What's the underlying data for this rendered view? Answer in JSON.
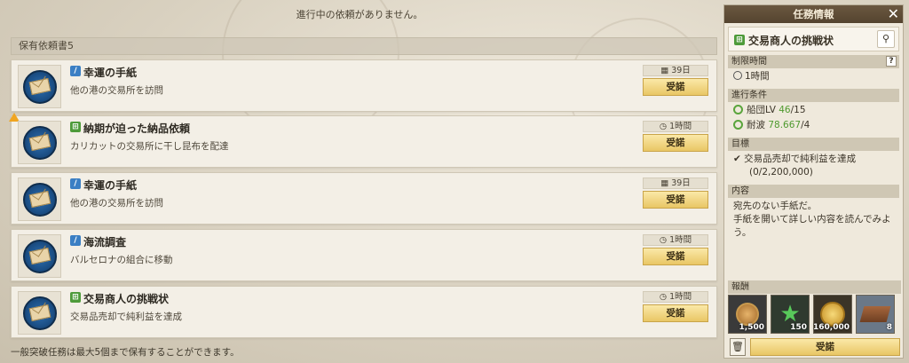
{
  "notice": "進行中の依頼がありません。",
  "list_header": "保有依頼書5",
  "accept_label": "受諾",
  "quests": [
    {
      "tag": "blue",
      "title": "幸運の手紙",
      "desc": "他の港の交易所を訪問",
      "time": "39日",
      "time_icon": "calendar-icon",
      "warning": false
    },
    {
      "tag": "green",
      "title": "納期が迫った納品依頼",
      "desc": "カリカットの交易所に干し昆布を配達",
      "time": "1時間",
      "time_icon": "clock-icon",
      "warning": true
    },
    {
      "tag": "blue",
      "title": "幸運の手紙",
      "desc": "他の港の交易所を訪問",
      "time": "39日",
      "time_icon": "calendar-icon",
      "warning": false
    },
    {
      "tag": "blue",
      "title": "海流調査",
      "desc": "バルセロナの組合に移動",
      "time": "1時間",
      "time_icon": "clock-icon",
      "warning": false
    },
    {
      "tag": "green",
      "title": "交易商人の挑戦状",
      "desc": "交易品売却で純利益を達成",
      "time": "1時間",
      "time_icon": "clock-icon",
      "warning": false
    }
  ],
  "footer": "一般突破任務は最大5個まで保有することができます。",
  "panel": {
    "title": "任務情報",
    "quest_name": "交易商人の挑戦状",
    "time_limit_label": "制限時間",
    "time_limit_value": "1時間",
    "conditions_label": "進行条件",
    "cond1_label": "船団LV",
    "cond1_current": "46",
    "cond1_required": "/15",
    "cond2_label": "耐波",
    "cond2_current": "78.667",
    "cond2_required": "/4",
    "goal_label": "目標",
    "goal_text": "交易品売却で純利益を達成",
    "goal_progress": "(0/2,200,000)",
    "content_label": "内容",
    "content_line1": "宛先のない手紙だ。",
    "content_line2": "手紙を開いて詳しい内容を読んでみよう。",
    "reward_label": "報酬",
    "rewards": [
      {
        "icon": "bronze-medal-icon",
        "count": "1,500"
      },
      {
        "icon": "green-star-icon",
        "count": "150"
      },
      {
        "icon": "gold-coin-icon",
        "count": "160,000"
      },
      {
        "icon": "timber-icon",
        "count": "8"
      }
    ],
    "accept_label": "受諾"
  },
  "colors": {
    "accent": "#e9c665",
    "title_bar": "#5e4c36",
    "green": "#4f9a2f",
    "blue_tag": "#3b7fc4"
  }
}
